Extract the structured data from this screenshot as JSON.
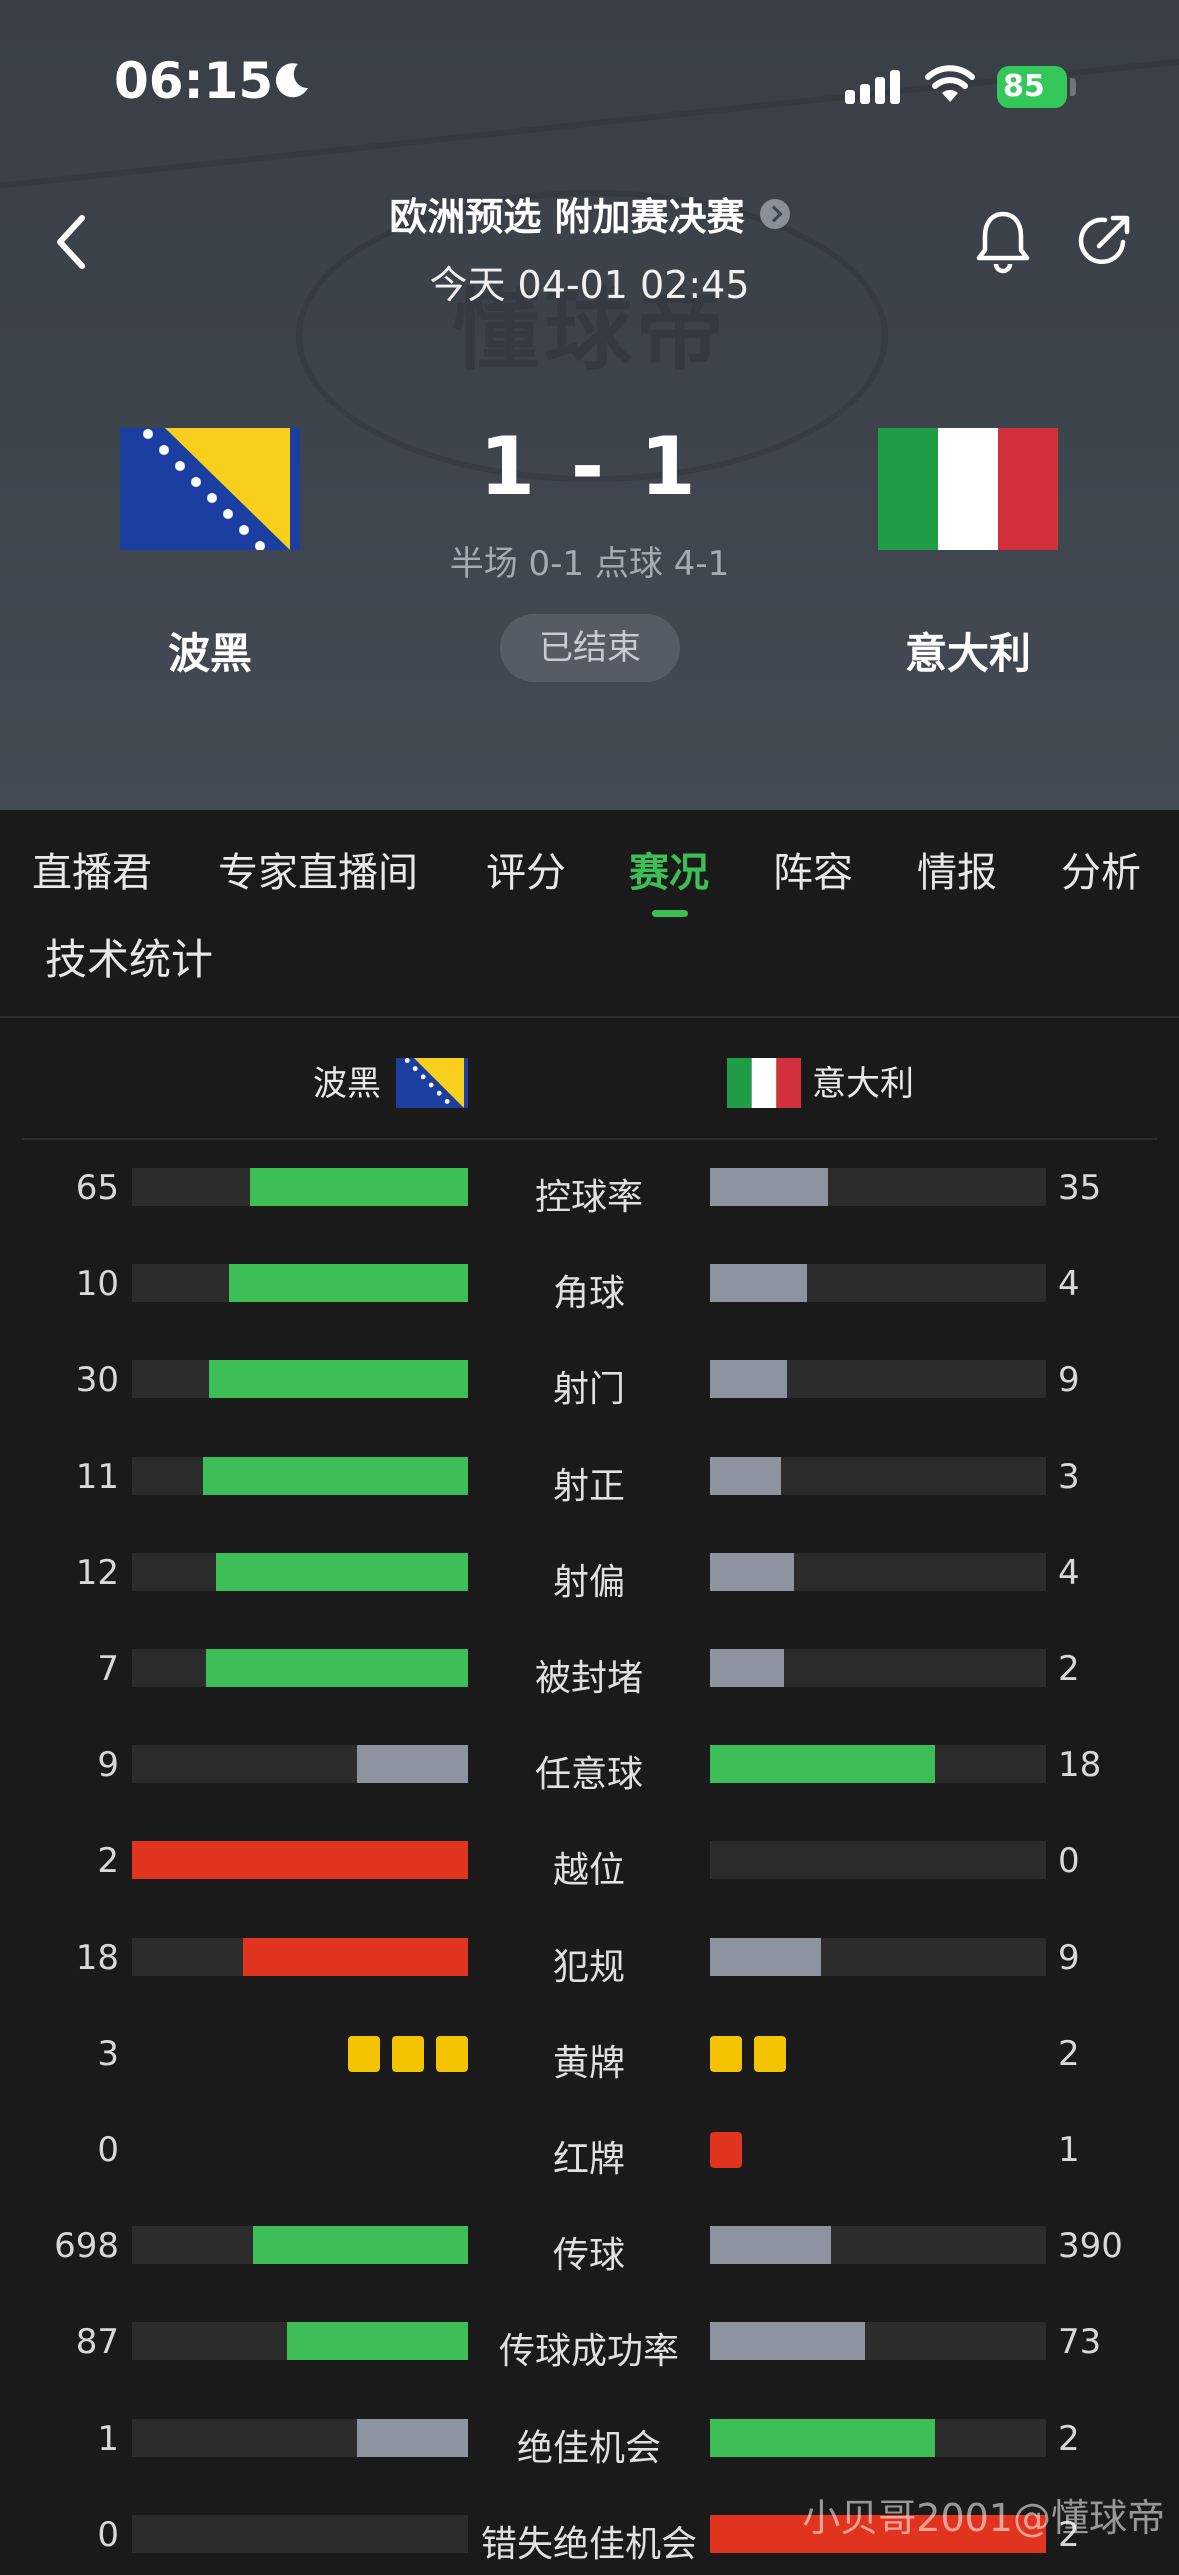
{
  "status_bar": {
    "time": "06:15",
    "battery": "85"
  },
  "header": {
    "competition": "欧洲预选 附加赛决赛",
    "match_time": "今天 04-01 02:45",
    "watermark": "懂球帝",
    "score": "1 - 1",
    "score_detail": "半场 0-1 点球 4-1",
    "status": "已结束",
    "home_team": "波黑",
    "away_team": "意大利"
  },
  "tabs": [
    "直播君",
    "专家直播间",
    "评分",
    "赛况",
    "阵容",
    "情报",
    "分析"
  ],
  "active_tab": "赛况",
  "section_title": "技术统计",
  "stats_header": {
    "home": "波黑",
    "away": "意大利"
  },
  "colors": {
    "green": "#3dbe57",
    "gray": "#8e949f",
    "red": "#e1341e",
    "yellow": "#f5c400"
  },
  "stats": [
    {
      "label": "控球率",
      "home": "65",
      "away": "35",
      "home_frac": 0.65,
      "away_frac": 0.35,
      "home_color": "green",
      "away_color": "gray"
    },
    {
      "label": "角球",
      "home": "10",
      "away": "4",
      "home_frac": 0.71,
      "away_frac": 0.29,
      "home_color": "green",
      "away_color": "gray"
    },
    {
      "label": "射门",
      "home": "30",
      "away": "9",
      "home_frac": 0.77,
      "away_frac": 0.23,
      "home_color": "green",
      "away_color": "gray"
    },
    {
      "label": "射正",
      "home": "11",
      "away": "3",
      "home_frac": 0.79,
      "away_frac": 0.21,
      "home_color": "green",
      "away_color": "gray"
    },
    {
      "label": "射偏",
      "home": "12",
      "away": "4",
      "home_frac": 0.75,
      "away_frac": 0.25,
      "home_color": "green",
      "away_color": "gray"
    },
    {
      "label": "被封堵",
      "home": "7",
      "away": "2",
      "home_frac": 0.78,
      "away_frac": 0.22,
      "home_color": "green",
      "away_color": "gray"
    },
    {
      "label": "任意球",
      "home": "9",
      "away": "18",
      "home_frac": 0.33,
      "away_frac": 0.67,
      "home_color": "gray",
      "away_color": "green"
    },
    {
      "label": "越位",
      "home": "2",
      "away": "0",
      "home_frac": 1.0,
      "away_frac": 0.0,
      "home_color": "red",
      "away_color": "gray"
    },
    {
      "label": "犯规",
      "home": "18",
      "away": "9",
      "home_frac": 0.67,
      "away_frac": 0.33,
      "home_color": "red",
      "away_color": "gray"
    },
    {
      "label": "黄牌",
      "home": "3",
      "away": "2",
      "cards": "yellow"
    },
    {
      "label": "红牌",
      "home": "0",
      "away": "1",
      "cards": "red"
    },
    {
      "label": "传球",
      "home": "698",
      "away": "390",
      "home_frac": 0.64,
      "away_frac": 0.36,
      "home_color": "green",
      "away_color": "gray"
    },
    {
      "label": "传球成功率",
      "home": "87",
      "away": "73",
      "home_frac": 0.54,
      "away_frac": 0.46,
      "home_color": "green",
      "away_color": "gray"
    },
    {
      "label": "绝佳机会",
      "home": "1",
      "away": "2",
      "home_frac": 0.33,
      "away_frac": 0.67,
      "home_color": "gray",
      "away_color": "green"
    },
    {
      "label": "错失绝佳机会",
      "home": "0",
      "away": "2",
      "home_frac": 0.0,
      "away_frac": 1.0,
      "home_color": "gray",
      "away_color": "red"
    }
  ],
  "footer_watermark": "小贝哥2001@懂球帝"
}
